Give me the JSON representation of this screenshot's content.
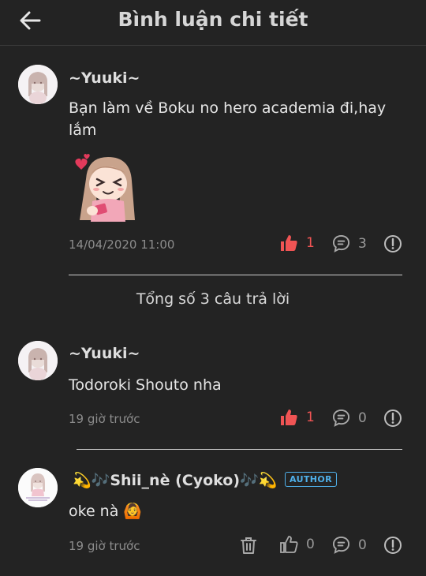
{
  "header": {
    "title": "Bình luận chi tiết",
    "back_icon": "arrow-left-icon"
  },
  "main_comment": {
    "username": "~Yuuki~",
    "text": "Bạn làm về Boku no hero academia đi,hay lắm",
    "sticker": "anime-girl-sticker",
    "timestamp": "14/04/2020 11:00",
    "likes": "1",
    "replies": "3"
  },
  "reply_total": "Tổng số 3 câu trả lời",
  "replies": [
    {
      "username": "~Yuuki~",
      "text": "Todoroki Shouto nha",
      "timestamp": "19 giờ trước",
      "likes": "1",
      "comments": "0"
    },
    {
      "username": "💫🎶Shii_nè (Cyoko)🎶💫",
      "badge": "AUTHOR",
      "text": "oke nà 🙆",
      "timestamp": "19 giờ trước",
      "likes": "0",
      "comments": "0"
    }
  ],
  "colors": {
    "background": "#232323",
    "like_active": "#f05454",
    "badge": "#4fb0ea"
  }
}
